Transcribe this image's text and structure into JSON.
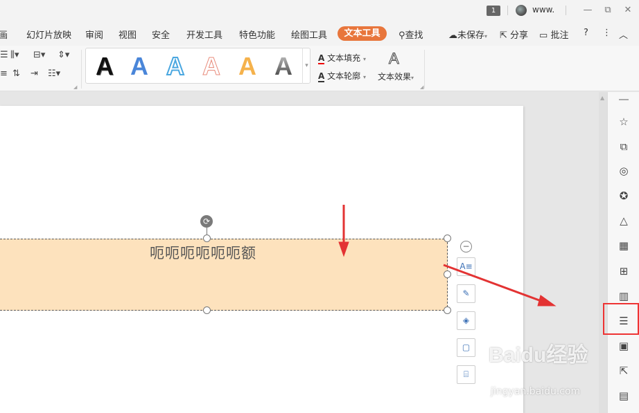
{
  "titlebar": {
    "badge": "1",
    "user": "www.",
    "minimize": "—",
    "restore": "⧉",
    "close": "✕"
  },
  "menu": {
    "items": [
      "画",
      "幻灯片放映",
      "审阅",
      "视图",
      "安全",
      "开发工具",
      "特色功能",
      "绘图工具"
    ],
    "active": "文本工具",
    "search": "查找",
    "unsaved": "未保存",
    "share": "分享",
    "comment": "批注",
    "help": "?",
    "more": "⋮",
    "collapse": "︿"
  },
  "ribbon": {
    "gallery_letter": "A",
    "text_fill": "文本填充",
    "text_outline": "文本轮廓",
    "text_effect": "文本效果"
  },
  "slide": {
    "textbox_text": "呃呃呃呃呃呃额"
  },
  "right_panel": {
    "icons": [
      "star-icon",
      "layers-icon",
      "shapes-icon",
      "award-icon",
      "fill-icon",
      "table-icon",
      "grid-icon",
      "chart-icon",
      "sliders-icon",
      "image-icon",
      "share-icon",
      "archive-icon"
    ]
  },
  "watermark": {
    "main": "Baidu经验",
    "sub": "jingyan.baidu.com"
  },
  "colors": {
    "accent": "#e8763c",
    "textbox_fill": "#fde2bd",
    "annotation": "#e33333"
  }
}
